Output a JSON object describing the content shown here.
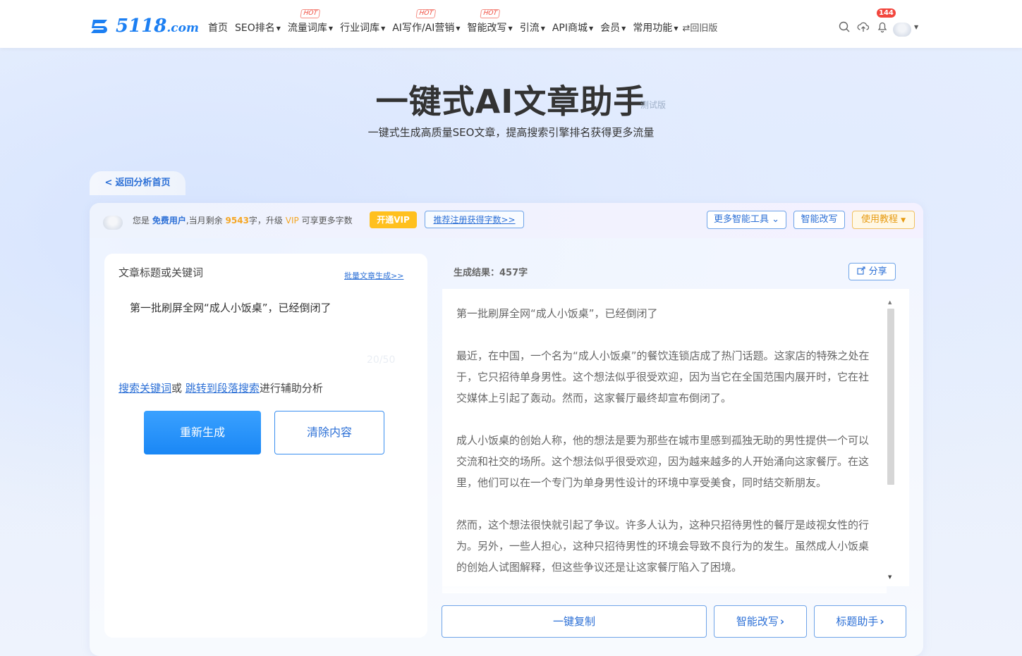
{
  "brand": {
    "logo_text": "5118",
    "logo_suffix": ".com",
    "color": "#1c7ff2"
  },
  "nav": {
    "items": [
      {
        "label": "首页",
        "dropdown": false,
        "hot": false
      },
      {
        "label": "SEO排名",
        "dropdown": true,
        "hot": false
      },
      {
        "label": "流量词库",
        "dropdown": true,
        "hot": true
      },
      {
        "label": "行业词库",
        "dropdown": true,
        "hot": false
      },
      {
        "label": "AI写作/AI营销",
        "dropdown": true,
        "hot": true
      },
      {
        "label": "智能改写",
        "dropdown": true,
        "hot": true
      },
      {
        "label": "引流",
        "dropdown": true,
        "hot": false
      },
      {
        "label": "API商城",
        "dropdown": true,
        "hot": false
      },
      {
        "label": "会员",
        "dropdown": true,
        "hot": false
      },
      {
        "label": "常用功能",
        "dropdown": true,
        "hot": false
      }
    ],
    "hot_label": "HOT",
    "old_version": "⇄回旧版",
    "notification_count": "144",
    "icons": [
      "search-icon",
      "cloud-upload-icon",
      "bell-icon"
    ]
  },
  "hero": {
    "title": "一键式AI文章助手",
    "beta": "测试版",
    "subtitle": "一键式生成高质量SEO文章，提高搜索引擎排名获得更多流量"
  },
  "back_button": "返回分析首页",
  "infobar": {
    "prefix": "您是",
    "user_type": "免费用户",
    "remaining_prefix": ",当月剩余",
    "remaining": "9543",
    "remaining_suffix": "字，升级",
    "vip": "VIP",
    "vip_suffix": "可享更多字数",
    "open_vip": "开通VIP",
    "recommend": "推荐注册获得字数>>",
    "more_tools": "更多智能工具",
    "smart_rewrite": "智能改写",
    "tutorial": "使用教程"
  },
  "left": {
    "label": "文章标题或关键词",
    "batch_link": "批量文章生成>>",
    "input_value": "第一批刷屏全网“成人小饭桌”，已经倒闭了",
    "char_count": "20/50",
    "assist_link1": "搜索关键词",
    "assist_or": "或",
    "assist_link2": "跳转到段落搜索",
    "assist_suffix": "进行辅助分析",
    "regenerate": "重新生成",
    "clear": "清除内容"
  },
  "right": {
    "result_label": "生成结果：",
    "result_count": "457字",
    "share": "分享",
    "paragraphs": [
      "第一批刷屏全网“成人小饭桌”，已经倒闭了",
      "最近，在中国，一个名为“成人小饭桌”的餐饮连锁店成了热门话题。这家店的特殊之处在于，它只招待单身男性。这个想法似乎很受欢迎，因为当它在全国范围内展开时，它在社交媒体上引起了轰动。然而，这家餐厅最终却宣布倒闭了。",
      "成人小饭桌的创始人称，他的想法是要为那些在城市里感到孤独无助的男性提供一个可以交流和社交的场所。这个想法似乎很受欢迎，因为越来越多的人开始涌向这家餐厅。在这里，他们可以在一个专门为单身男性设计的环境中享受美食，同时结交新朋友。",
      "然而，这个想法很快就引起了争议。许多人认为，这种只招待男性的餐厅是歧视女性的行为。另外，一些人担心，这种只招待男性的环境会导致不良行为的发生。虽然成人小饭桌的创始人试图解释，但这些争议还是让这家餐厅陷入了困境。"
    ],
    "copy": "一键复制",
    "smart_rewrite": "智能改写",
    "headline_helper": "标题助手"
  }
}
